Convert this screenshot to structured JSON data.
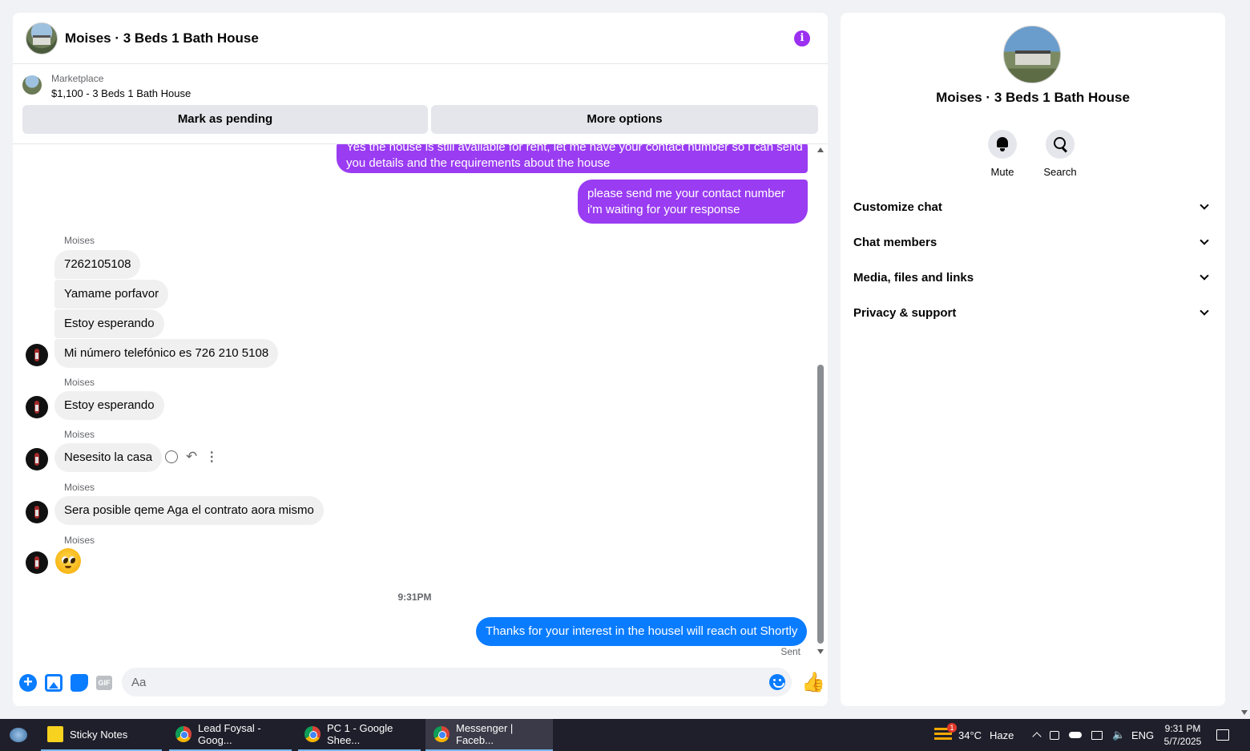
{
  "chat": {
    "title": "Moises · 3 Beds 1 Bath House",
    "listing": {
      "source": "Marketplace",
      "price_title": "$1,100 - 3 Beds 1 Bath House",
      "mark_pending": "Mark as pending",
      "more_options": "More options"
    },
    "messages": {
      "out1": "Yes the house is still available for rent, let me have your contact number so i can send",
      "out1b": "you details and the requirements about the house",
      "out2a": "please send me your contact number",
      "out2b": "i'm waiting for your response",
      "sender": "Moises",
      "in1": "7262105108",
      "in2": "Yamame porfavor",
      "in3": "Estoy esperando",
      "in4": "Mi número telefónico es 726 210 5108",
      "in5": "Estoy esperando",
      "in6": "Nesesito la casa",
      "in7": "Sera posible qeme Aga el contrato aora mismo",
      "time": "9:31PM",
      "out3": "Thanks for your interest in the housel will reach out Shortly",
      "status": "Sent"
    },
    "composer": {
      "placeholder": "Aa",
      "gif": "GIF"
    }
  },
  "panel": {
    "title": "Moises · 3 Beds 1 Bath House",
    "mute": "Mute",
    "search": "Search",
    "sections": [
      "Customize chat",
      "Chat members",
      "Media, files and links",
      "Privacy & support"
    ]
  },
  "taskbar": {
    "sticky": "Sticky Notes",
    "lead": "Lead Foysal - Goog...",
    "pc1": "PC 1 - Google Shee...",
    "messenger": "Messenger | Faceb...",
    "weather_badge": "1",
    "temp": "34°C",
    "weather": "Haze",
    "lang": "ENG",
    "time": "9:31 PM",
    "date": "5/7/2025"
  },
  "colors": {
    "accent_purple": "#9a3cf2",
    "accent_blue": "#0a7cff"
  }
}
